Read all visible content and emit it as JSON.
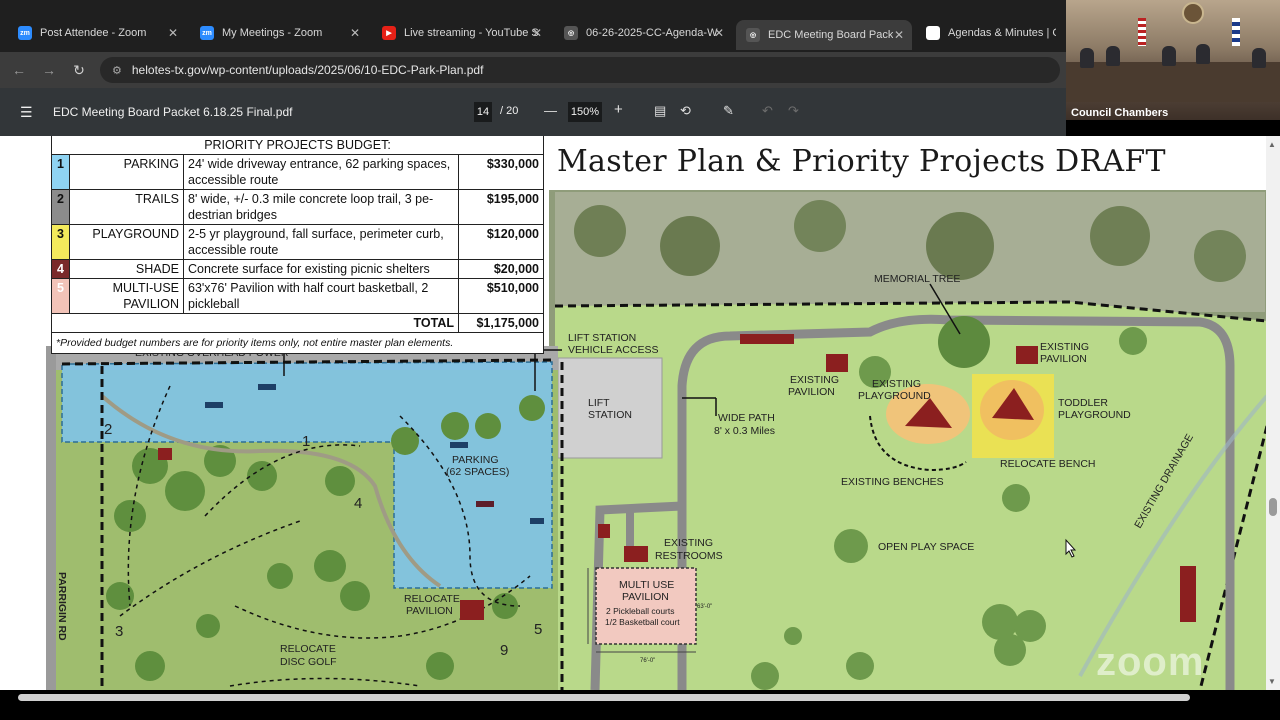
{
  "tabs": [
    {
      "title": "Post Attendee - Zoom",
      "icon": "zoom-icon",
      "fav_text": "zm"
    },
    {
      "title": "My Meetings - Zoom",
      "icon": "zoom-icon",
      "fav_text": "zm"
    },
    {
      "title": "Live streaming - YouTube S",
      "icon": "youtube-icon",
      "fav_text": "▶"
    },
    {
      "title": "06-26-2025-CC-Agenda-W",
      "icon": "globe-icon",
      "fav_text": "◎"
    },
    {
      "title": "EDC Meeting Board Packet",
      "icon": "globe-icon",
      "fav_text": "◎"
    },
    {
      "title": "Agendas & Minutes | City o",
      "icon": "page-icon",
      "fav_text": ""
    }
  ],
  "tab_close": "✕",
  "address": {
    "url": "helotes-tx.gov/wp-content/uploads/2025/06/10-EDC-Park-Plan.pdf"
  },
  "pdf_toolbar": {
    "menu_icon": "☰",
    "filename": "EDC Meeting Board Packet 6.18.25 Final.pdf",
    "page": "14",
    "page_total": "/ 20",
    "zoom_minus": "—",
    "zoom": "150%",
    "zoom_plus": "+"
  },
  "video": {
    "label": "Council Chambers"
  },
  "budget": {
    "header": "PRIORITY PROJECTS BUDGET:",
    "rows": [
      {
        "num": "1",
        "category": "PARKING",
        "desc": "24' wide driveway entrance, 62 parking spaces, accessible route",
        "amount": "$330,000",
        "color": "#8fd3f2"
      },
      {
        "num": "2",
        "category": "TRAILS",
        "desc": "8' wide, +/- 0.3 mile concrete loop trail, 3 pe-destrian bridges",
        "amount": "$195,000",
        "color": "#8c8c8c"
      },
      {
        "num": "3",
        "category": "PLAYGROUND",
        "desc": "2-5 yr playground, fall surface, perimeter curb, accessible route",
        "amount": "$120,000",
        "color": "#f4ea5c"
      },
      {
        "num": "4",
        "category": "SHADE",
        "desc": "Concrete surface for existing picnic shelters",
        "amount": "$20,000",
        "color": "#7a2a2a"
      },
      {
        "num": "5",
        "category": "MULTI-USE PAVILION",
        "desc": "63'x76' Pavilion with half court basketball, 2 pickleball",
        "amount": "$510,000",
        "color": "#f2c3b8"
      }
    ],
    "total_label": "TOTAL",
    "total": "$1,175,000",
    "note": "*Provided budget numbers are for priority items only, not entire master plan elements."
  },
  "plan_title": "Master Plan & Priority Projects DRAFT",
  "map_labels": {
    "overhead_power": "EXISTING OVERHEAD POWER",
    "lift_station_access_1": "LIFT STATION",
    "lift_station_access_2": "VEHICLE ACCESS",
    "lift_station_1": "LIFT",
    "lift_station_2": "STATION",
    "wide_path_1": "WIDE PATH",
    "wide_path_2": "8' x 0.3 Miles",
    "memorial_tree": "MEMORIAL TREE",
    "existing_pavilion": "EXISTING",
    "pavilion_word": "PAVILION",
    "existing_playground_1": "EXISTING",
    "existing_playground_2": "PLAYGROUND",
    "toddler_1": "TODDLER",
    "toddler_2": "PLAYGROUND",
    "relocate_bench": "RELOCATE BENCH",
    "existing_benches": "EXISTING BENCHES",
    "open_play": "OPEN PLAY SPACE",
    "existing_drainage": "EXISTING DRAINAGE",
    "existing_restrooms_1": "EXISTING",
    "existing_restrooms_2": "RESTROOMS",
    "multi_use_1": "MULTI USE",
    "multi_use_2": "PAVILION",
    "multi_use_3": "2 Pickleball courts",
    "multi_use_4": "1/2 Basketball court",
    "parking_1": "PARKING",
    "parking_2": "(62 SPACES)",
    "relocate_pavilion_1": "RELOCATE",
    "relocate_pavilion_2": "PAVILION",
    "relocate_disc_1": "RELOCATE",
    "relocate_disc_2": "DISC GOLF",
    "road": "PARRIGIN RD",
    "n1": "1",
    "n2": "2",
    "n3": "3",
    "n4": "4",
    "n5": "5",
    "n9": "9",
    "dim_63": "63'-0\"",
    "dim_76": "76'-0\""
  },
  "watermark": "zoom",
  "colors": {
    "parking": "#7fc3e8",
    "grass": "#b9d98a",
    "path": "#8a8a8a",
    "playground": "#f2e24a",
    "pavilion": "#8b1f1f",
    "multi_use": "#f2c9c0"
  }
}
